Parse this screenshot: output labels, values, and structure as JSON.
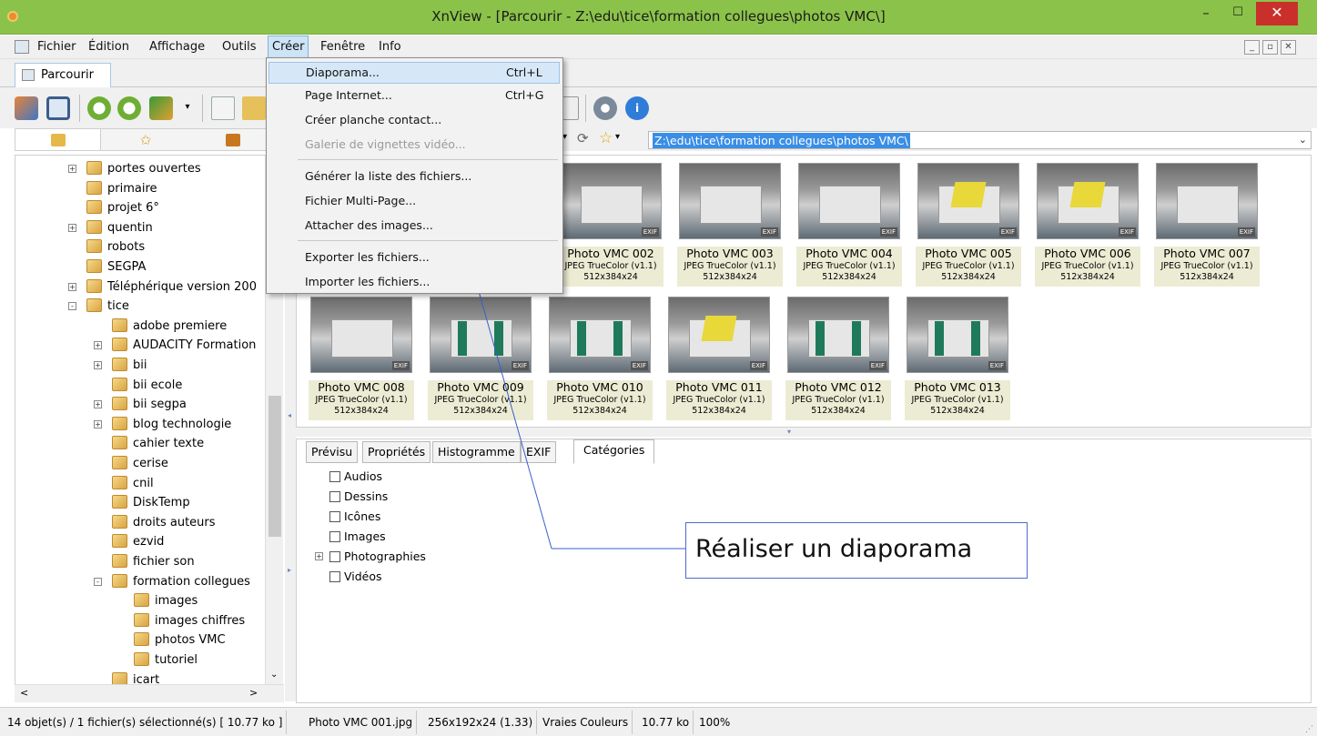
{
  "window": {
    "title": "XnView - [Parcourir - Z:\\edu\\tice\\formation collegues\\photos VMC\\]",
    "minimize_label": "–",
    "maximize_label": "☐",
    "close_label": "✕"
  },
  "menubar": {
    "items": [
      "Fichier",
      "Édition",
      "Affichage",
      "Outils",
      "Créer",
      "Fenêtre",
      "Info"
    ],
    "active": "Créer"
  },
  "tabs": {
    "browse_label": "Parcourir"
  },
  "create_menu": {
    "items": [
      {
        "label": "Diaporama...",
        "shortcut": "Ctrl+L",
        "highlighted": true
      },
      {
        "label": "Page Internet...",
        "shortcut": "Ctrl+G"
      },
      {
        "label": "Créer planche contact..."
      },
      {
        "label": "Galerie de vignettes vidéo...",
        "disabled": true
      },
      {
        "label": "Générer la liste des fichiers..."
      },
      {
        "label": "Fichier Multi-Page..."
      },
      {
        "label": "Attacher des images..."
      },
      {
        "label": "Exporter les fichiers..."
      },
      {
        "label": "Importer les fichiers..."
      }
    ]
  },
  "address_bar": {
    "path": "Z:\\edu\\tice\\formation collegues\\photos VMC\\"
  },
  "folder_tree": {
    "items": [
      {
        "label": "portes ouvertes",
        "level": 0,
        "expander": "+"
      },
      {
        "label": "primaire",
        "level": 0
      },
      {
        "label": "projet 6°",
        "level": 0
      },
      {
        "label": "quentin",
        "level": 0,
        "expander": "+"
      },
      {
        "label": "robots",
        "level": 0
      },
      {
        "label": "SEGPA",
        "level": 0
      },
      {
        "label": "Téléphérique version 200",
        "level": 0,
        "expander": "+"
      },
      {
        "label": "tice",
        "level": 0,
        "expander": "-"
      },
      {
        "label": "adobe premiere",
        "level": 1
      },
      {
        "label": "AUDACITY Formation",
        "level": 1,
        "expander": "+"
      },
      {
        "label": "bii",
        "level": 1,
        "expander": "+"
      },
      {
        "label": "bii ecole",
        "level": 1
      },
      {
        "label": "bii segpa",
        "level": 1,
        "expander": "+"
      },
      {
        "label": "blog technologie",
        "level": 1,
        "expander": "+"
      },
      {
        "label": "cahier texte",
        "level": 1
      },
      {
        "label": "cerise",
        "level": 1
      },
      {
        "label": "cnil",
        "level": 1
      },
      {
        "label": "DiskTemp",
        "level": 1
      },
      {
        "label": "droits auteurs",
        "level": 1
      },
      {
        "label": "ezvid",
        "level": 1
      },
      {
        "label": "fichier son",
        "level": 1
      },
      {
        "label": "formation collegues",
        "level": 1,
        "expander": "-"
      },
      {
        "label": "images",
        "level": 2
      },
      {
        "label": "images chiffres",
        "level": 2
      },
      {
        "label": "photos VMC",
        "level": 2
      },
      {
        "label": "tutoriel",
        "level": 2
      },
      {
        "label": "icart",
        "level": 1
      }
    ]
  },
  "thumbnails": [
    {
      "name": "Photo  VMC 002",
      "format": "JPEG TrueColor (v1.1)",
      "dims": "512x384x24",
      "badge": "EXIF",
      "style": "plain"
    },
    {
      "name": "Photo  VMC 003",
      "format": "JPEG TrueColor (v1.1)",
      "dims": "512x384x24",
      "badge": "EXIF",
      "style": "plain"
    },
    {
      "name": "Photo  VMC 004",
      "format": "JPEG TrueColor (v1.1)",
      "dims": "512x384x24",
      "badge": "EXIF",
      "style": "plain"
    },
    {
      "name": "Photo  VMC 005",
      "format": "JPEG TrueColor (v1.1)",
      "dims": "512x384x24",
      "badge": "EXIF",
      "style": "yellow"
    },
    {
      "name": "Photo  VMC 006",
      "format": "JPEG TrueColor (v1.1)",
      "dims": "512x384x24",
      "badge": "EXIF",
      "style": "yellow"
    },
    {
      "name": "Photo  VMC 007",
      "format": "JPEG TrueColor (v1.1)",
      "dims": "512x384x24",
      "badge": "EXIF",
      "style": "plain"
    },
    {
      "name": "Photo  VMC 008",
      "format": "JPEG TrueColor (v1.1)",
      "dims": "512x384x24",
      "badge": "EXIF",
      "style": "plain"
    },
    {
      "name": "Photo  VMC 009",
      "format": "JPEG TrueColor (v1.1)",
      "dims": "512x384x24",
      "badge": "EXIF",
      "style": "green"
    },
    {
      "name": "Photo  VMC 010",
      "format": "JPEG TrueColor (v1.1)",
      "dims": "512x384x24",
      "badge": "EXIF",
      "style": "green"
    },
    {
      "name": "Photo  VMC 011",
      "format": "JPEG TrueColor (v1.1)",
      "dims": "512x384x24",
      "badge": "EXIF",
      "style": "yellow"
    },
    {
      "name": "Photo  VMC 012",
      "format": "JPEG TrueColor (v1.1)",
      "dims": "512x384x24",
      "badge": "EXIF",
      "style": "green"
    },
    {
      "name": "Photo  VMC 013",
      "format": "JPEG TrueColor (v1.1)",
      "dims": "512x384x24",
      "badge": "EXIF",
      "style": "green"
    }
  ],
  "property_tabs": {
    "items": [
      "Prévisu",
      "Propriétés",
      "Histogramme",
      "EXIF",
      "Catégories"
    ],
    "active": "Catégories"
  },
  "categories": [
    {
      "label": "Audios"
    },
    {
      "label": "Dessins"
    },
    {
      "label": "Icônes"
    },
    {
      "label": "Images"
    },
    {
      "label": "Photographies",
      "expander": "+"
    },
    {
      "label": "Vidéos"
    }
  ],
  "annotation": {
    "text": "Réaliser un diaporama"
  },
  "statusbar": {
    "selection": "14 objet(s) / 1 fichier(s) sélectionné(s)  [ 10.77 ko ]",
    "filename": "Photo  VMC 001.jpg",
    "image_info": "256x192x24 (1.33)",
    "color_mode": "Vraies Couleurs",
    "file_size": "10.77 ko",
    "zoom": "100%"
  },
  "colors": {
    "titlebar": "#8bc34a",
    "menu_highlight": "#d6e8f8",
    "address_selection": "#3a8ee6",
    "caption_bg": "#ececd4",
    "callout_border": "#4f6bcc"
  }
}
